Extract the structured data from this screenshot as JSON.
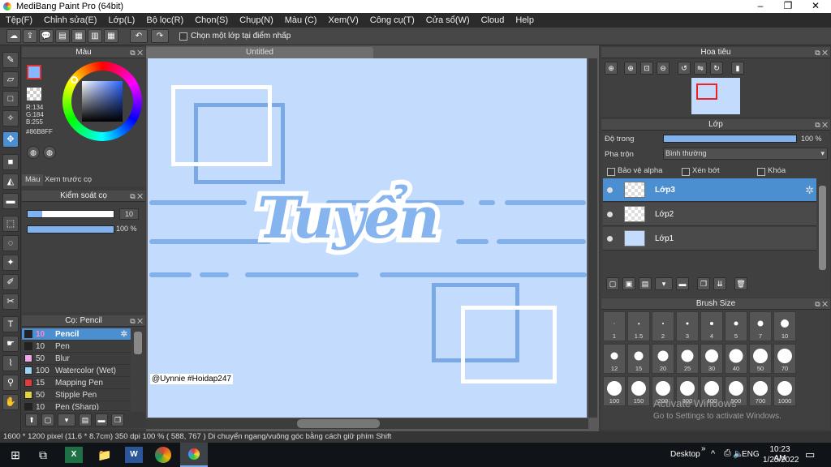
{
  "window": {
    "title": "MediBang Paint Pro (64bit)",
    "minimize": "–",
    "maximize": "❐",
    "close": "✕"
  },
  "menu": [
    "Tệp(F)",
    "Chỉnh sửa(E)",
    "Lớp(L)",
    "Bộ lọc(R)",
    "Chọn(S)",
    "Chụp(N)",
    "Màu (C)",
    "Xem(V)",
    "Công cụ(T)",
    "Cửa sổ(W)",
    "Cloud",
    "Help"
  ],
  "toolbar": {
    "checkbox_label": "Chọn một lớp tại điểm nhấp"
  },
  "color_panel": {
    "title": "Màu",
    "r": "R:134",
    "g": "G:184",
    "b": "B:255",
    "hex": "#86B8FF",
    "tabs": [
      "Màu",
      "Xem trước cọ"
    ],
    "primary": "#86b8ff"
  },
  "brush_control": {
    "title": "Kiểm soát cọ",
    "size": "10",
    "opacity": "100 %",
    "opacity_value": 100
  },
  "brush_list": {
    "title": "Cọ: Pencil",
    "items": [
      {
        "size": "10",
        "name": "Pencil",
        "color": "#222222",
        "selected": true
      },
      {
        "size": "10",
        "name": "Pen",
        "color": "#222222"
      },
      {
        "size": "50",
        "name": "Blur",
        "color": "#f2a6e8"
      },
      {
        "size": "100",
        "name": "Watercolor (Wet)",
        "color": "#9cd4f7"
      },
      {
        "size": "15",
        "name": "Mapping Pen",
        "color": "#e23b3b"
      },
      {
        "size": "50",
        "name": "Stipple Pen",
        "color": "#e2d23b"
      },
      {
        "size": "10",
        "name": "Pen (Sharp)",
        "color": "#222222"
      }
    ]
  },
  "canvas": {
    "doc_tab": "Untitled",
    "text": "Tuyển",
    "watermark": "@Uynnie #Hoidap247",
    "bg": "#c3dcfd"
  },
  "navigator": {
    "title": "Hoa tiêu"
  },
  "layer_panel": {
    "title": "Lớp",
    "opacity_label": "Độ trong",
    "opacity_value": "100 %",
    "opacity_fraction": 1.0,
    "blend_label": "Pha trộn",
    "blend_value": "Bình thường",
    "protect_alpha": "Bảo vệ alpha",
    "clipping": "Xén bớt",
    "lock": "Khóa",
    "layers": [
      "Lớp3",
      "Lớp2",
      "Lớp1"
    ]
  },
  "brush_size": {
    "title": "Brush Size",
    "sizes": [
      "1",
      "1.5",
      "2",
      "3",
      "4",
      "5",
      "7",
      "10",
      "12",
      "15",
      "20",
      "25",
      "30",
      "40",
      "50",
      "70",
      "100",
      "150",
      "200",
      "300",
      "400",
      "500",
      "700",
      "1000"
    ]
  },
  "activate": {
    "line1": "Activate Windows",
    "line2": "Go to Settings to activate Windows."
  },
  "status": "1600 * 1200 pixel   (11.6 * 8.7cm)  350 dpi  100 %  ( 588, 767 )  Di chuyển ngang/vuông góc bằng cách giữ phím Shift",
  "taskbar": {
    "desktop": "Desktop",
    "lang": "ENG",
    "time": "10:23 AM",
    "date": "1/25/2022"
  }
}
